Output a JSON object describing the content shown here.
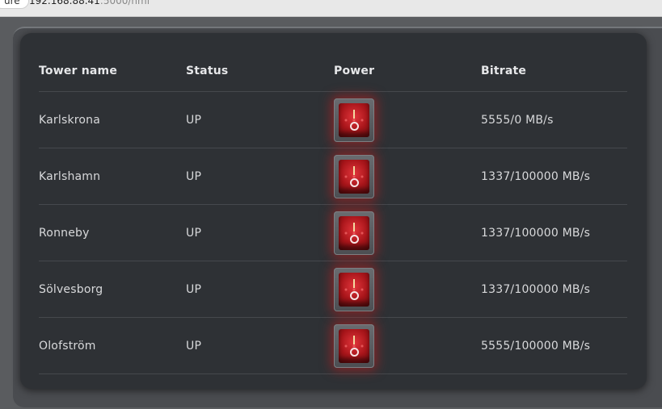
{
  "browser": {
    "secure_label": "ure",
    "url_host": "192.168.88.41",
    "url_rest": ":5000/hmi"
  },
  "table": {
    "headers": {
      "name": "Tower name",
      "status": "Status",
      "power": "Power",
      "bitrate": "Bitrate"
    },
    "rows": [
      {
        "name": "Karlskrona",
        "status": "UP",
        "bitrate": "5555/0  MB/s"
      },
      {
        "name": "Karlshamn",
        "status": "UP",
        "bitrate": "1337/100000  MB/s"
      },
      {
        "name": "Ronneby",
        "status": "UP",
        "bitrate": "1337/100000  MB/s"
      },
      {
        "name": "Sölvesborg",
        "status": "UP",
        "bitrate": "1337/100000  MB/s"
      },
      {
        "name": "Olofström",
        "status": "UP",
        "bitrate": "5555/100000  MB/s"
      }
    ]
  },
  "colors": {
    "panel": "#2e3135",
    "switch_red": "#c0161c"
  },
  "icons": {
    "power_switch": "power-toggle-icon"
  }
}
